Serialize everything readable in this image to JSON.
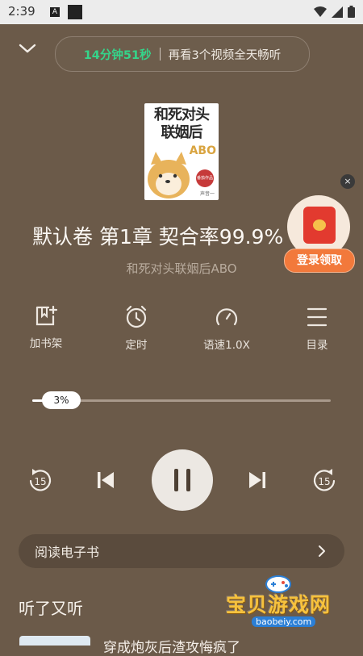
{
  "status_bar": {
    "time": "2:39",
    "a_glyph": "A"
  },
  "header": {
    "timer_value": "14分钟51秒",
    "timer_cta": "再看3个视频全天畅听",
    "accent_green": "#35d48a"
  },
  "cover": {
    "title_line1": "和死对头",
    "title_line2": "联姻后",
    "tag": "ABO",
    "badge": "番茄作品",
    "author": "声音一"
  },
  "now_playing": {
    "chapter_title": "默认卷 第1章 契合率99.9%",
    "book_title": "和死对头联姻后ABO"
  },
  "ad": {
    "button_label": "登录领取",
    "close_glyph": "×"
  },
  "functions": [
    {
      "label": "加书架",
      "icon": "add-bookshelf-icon"
    },
    {
      "label": "定时",
      "icon": "alarm-clock-icon"
    },
    {
      "label": "语速1.0X",
      "icon": "speed-gauge-icon"
    },
    {
      "label": "目录",
      "icon": "menu-list-icon"
    }
  ],
  "progress": {
    "label": "3%",
    "value": 0.03
  },
  "controls": {
    "rewind_seconds": "15",
    "forward_seconds": "15"
  },
  "read_ebook": {
    "label": "阅读电子书"
  },
  "recommendations": {
    "section_title": "听了又听",
    "items": [
      {
        "title": "穿成炮灰后渣攻悔疯了"
      }
    ]
  },
  "watermark": {
    "text": "宝贝游戏网",
    "url": "baobeiy.com"
  }
}
